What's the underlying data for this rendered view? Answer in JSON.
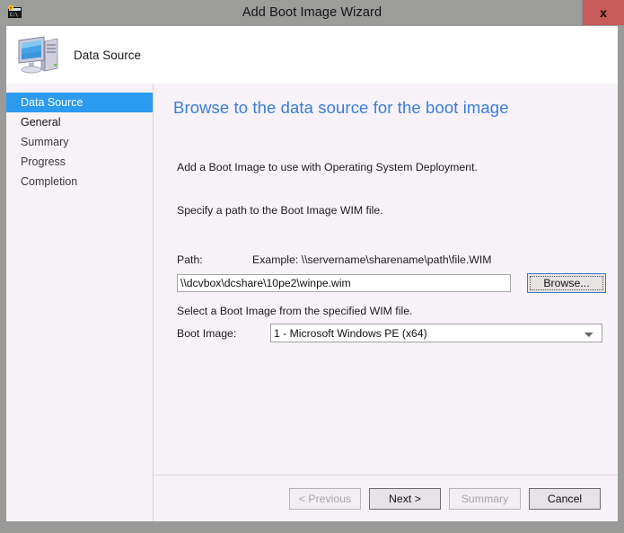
{
  "window": {
    "title": "Add Boot Image Wizard",
    "icon": "console-wizard-icon",
    "close_label": "x"
  },
  "header": {
    "icon": "computer-icon",
    "title": "Data Source"
  },
  "sidebar": {
    "items": [
      {
        "label": "Data Source",
        "state": "selected"
      },
      {
        "label": "General",
        "state": "active"
      },
      {
        "label": "Summary",
        "state": "normal"
      },
      {
        "label": "Progress",
        "state": "normal"
      },
      {
        "label": "Completion",
        "state": "normal"
      }
    ]
  },
  "main": {
    "heading": "Browse to the data source for the boot image",
    "paragraph_1": "Add a Boot Image to use with Operating System Deployment.",
    "paragraph_2": "Specify a path to the Boot Image WIM file.",
    "path_label": "Path:",
    "path_example": "Example: \\\\servername\\sharename\\path\\file.WIM",
    "path_value": "\\\\dcvbox\\dcshare\\10pe2\\winpe.wim",
    "path_placeholder": "",
    "browse_label": "Browse...",
    "select_hint": "Select a Boot Image from the specified WIM file.",
    "boot_image_label": "Boot Image:",
    "boot_image_selected": "1 - Microsoft Windows PE (x64)",
    "boot_image_options": [
      "1 - Microsoft Windows PE (x64)"
    ]
  },
  "footer": {
    "previous_label": "< Previous",
    "next_label": "Next >",
    "summary_label": "Summary",
    "cancel_label": "Cancel"
  },
  "colors": {
    "titlebar": "#9c9c9b",
    "close_button": "#c75b5b",
    "body_background": "#f7f2f7",
    "heading_blue": "#3a7ddd",
    "selection_blue": "#2b9bf0",
    "focus_border": "#3b78c3"
  }
}
